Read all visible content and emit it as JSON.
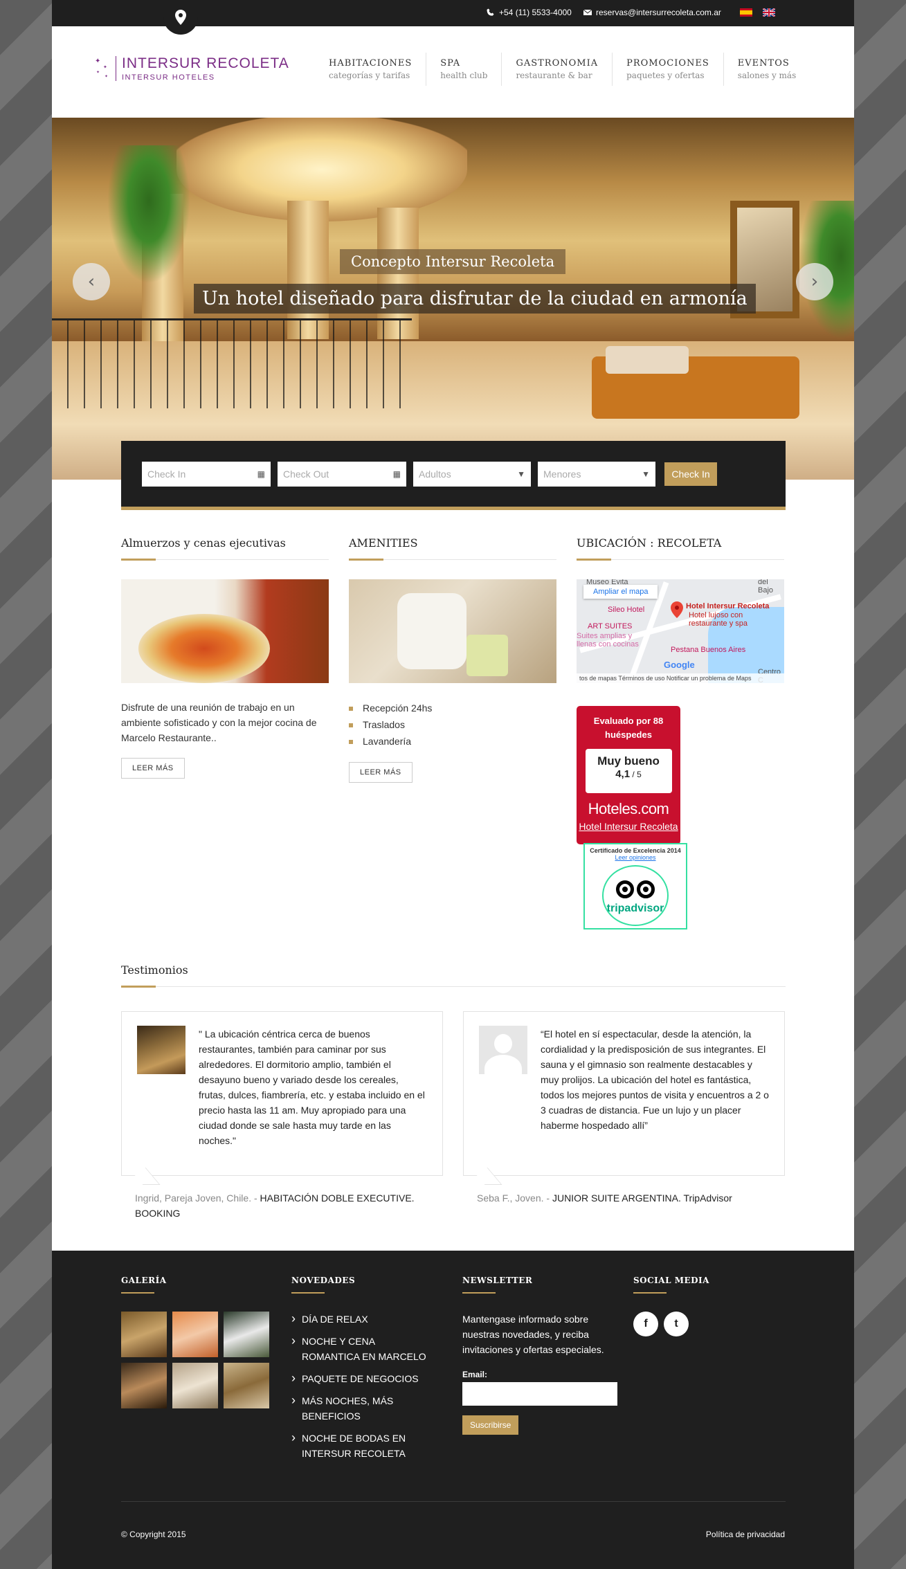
{
  "topbar": {
    "phone": "+54 (11) 5533-4000",
    "email": "reservas@intersurrecoleta.com.ar",
    "languages": [
      "es",
      "en"
    ]
  },
  "logo": {
    "name": "INTERSUR RECOLETA",
    "sub": "INTERSUR HOTELES",
    "color": "#7b2d86"
  },
  "nav": [
    {
      "title": "HABITACIONES",
      "subtitle": "categorías y tarifas"
    },
    {
      "title": "SPA",
      "subtitle": "health club"
    },
    {
      "title": "GASTRONOMIA",
      "subtitle": "restaurante & bar"
    },
    {
      "title": "PROMOCIONES",
      "subtitle": "paquetes y ofertas"
    },
    {
      "title": "EVENTOS",
      "subtitle": "salones y más"
    }
  ],
  "hero": {
    "kicker": "Concepto Intersur Recoleta",
    "title": "Un hotel diseñado para disfrutar de la ciudad en armonía",
    "prev": "‹",
    "next": "›"
  },
  "booking": {
    "checkin": "Check In",
    "checkout": "Check Out",
    "adults": "Adultos",
    "minors": "Menores",
    "submit": "Check In"
  },
  "sections": {
    "lunch": {
      "title": "Almuerzos y cenas ejecutivas",
      "text": "Disfrute de una reunión de trabajo en un ambiente sofisticado y con la mejor cocina de Marcelo Restaurante..",
      "button": "LEER MÁS"
    },
    "amenities": {
      "title": "AMENITIES",
      "items": [
        "Recepción 24hs",
        "Traslados",
        "Lavandería"
      ],
      "button": "LEER MÁS"
    },
    "location": {
      "title": "UBICACIÓN : RECOLETA",
      "map_link": "Ampliar el mapa",
      "labels": {
        "museum": "Museo Evita",
        "sileo": "Sileo Hotel",
        "hotel": "Hotel Intersur Recoleta",
        "hotel_desc": "Hotel lujoso con restaurante y spa",
        "art": "ART SUITES",
        "art_desc": "Suites amplias y llenas con cocinas",
        "pestana": "Pestana Buenos Aires",
        "bajo": "del Bajo",
        "centro": "Centro C",
        "google": "Google"
      },
      "footer": "tos de mapas   Términos de uso   Notificar un problema de Maps"
    }
  },
  "hoteles_badge": {
    "top": "Evaluado por 88 huéspedes",
    "rating": "Muy bueno",
    "score": "4,1",
    "scale": " / 5",
    "brand": "Hoteles.com",
    "hotel": "Hotel Intersur Recoleta"
  },
  "tripadvisor": {
    "cert": "Certificado de Excelencia 2014",
    "read": "Leer opiniones",
    "brand": "tripadvisor"
  },
  "testimonials": {
    "title": "Testimonios",
    "items": [
      {
        "quote": "\" La ubicación céntrica cerca de buenos restaurantes, también para caminar por sus alrededores. El dormitorio amplio, también el desayuno bueno y variado desde los cereales, frutas, dulces, fiambrería, etc. y estaba incluido en el precio hasta las 11 am. Muy apropiado para una ciudad donde se sale hasta muy tarde en las noches.\"",
        "author": "Ingrid, Pareja Joven, Chile. - ",
        "stay": "HABITACIÓN DOBLE EXECUTIVE. BOOKING"
      },
      {
        "quote": "“El hotel en sí espectacular, desde la atención, la cordialidad y la predisposición de sus integrantes. El sauna y el gimnasio son realmente destacables y muy prolijos. La ubicación del hotel es fantástica, todos los mejores puntos de visita y encuentros a 2 o 3 cuadras de distancia. Fue un lujo y un placer haberme hospedado allí”",
        "author": "Seba F., Joven. - ",
        "stay": "JUNIOR SUITE ARGENTINA. TripAdvisor"
      }
    ]
  },
  "footer": {
    "gallery_title": "GALERÍA",
    "news_title": "NOVEDADES",
    "news": [
      "DÍA DE RELAX",
      "NOCHE Y CENA ROMANTICA EN MARCELO",
      "PAQUETE DE NEGOCIOS",
      "MÁS NOCHES, MÁS BENEFICIOS",
      "NOCHE DE BODAS EN INTERSUR RECOLETA"
    ],
    "newsletter_title": "NEWSLETTER",
    "newsletter_text": "Mantengase informado sobre nuestras novedades, y reciba invitaciones y ofertas especiales.",
    "email_label": "Email:",
    "subscribe": "Suscribirse",
    "social_title": "SOCIAL MEDIA",
    "social": [
      "f",
      "t"
    ],
    "copyright": "© Copyright 2015",
    "privacy": "Política de privacidad"
  },
  "colors": {
    "accent": "#c19e5b",
    "dark": "#1f1f1f",
    "hoteles_red": "#c8102e",
    "tripadvisor_green": "#34e0a1"
  }
}
